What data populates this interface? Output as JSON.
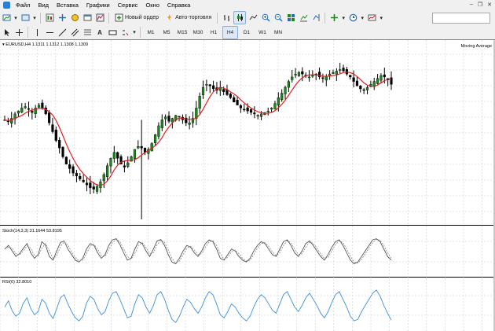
{
  "menu": [
    "Файл",
    "Вид",
    "Вставка",
    "Графики",
    "Сервис",
    "Окно",
    "Справка"
  ],
  "toolbar": {
    "new_order_label": "Новый ордер",
    "autotrading_label": "Авто-торговля"
  },
  "timeframes": [
    "M1",
    "M5",
    "M15",
    "M30",
    "H1",
    "H4",
    "D1",
    "W1",
    "MN"
  ],
  "drawing_tools": {
    "text_tool_label": "A"
  },
  "chart": {
    "header": "EURUSD,H4  1.1311 1.1312 1.1308 1.1309",
    "indicator_label": "Moving Average",
    "stoch_label": "Stoch(14,3,3) 31.1644 53.8195",
    "rsi_label": "RSI(6) 32.8010"
  },
  "colors": {
    "bull_candle": "#1a8a1a",
    "bear_candle": "#000000",
    "moving_average": "#e02020",
    "stochastic_main": "#404040",
    "stochastic_signal": "#808080",
    "rsi": "#3b8fdc",
    "grid": "#c8c8c8"
  },
  "chart_data": {
    "type": "candlestick",
    "symbol": "EURUSD",
    "timeframe": "H4",
    "price_path": [
      0.62,
      0.61,
      0.63,
      0.66,
      0.68,
      0.7,
      0.71,
      0.69,
      0.67,
      0.7,
      0.72,
      0.7,
      0.66,
      0.6,
      0.54,
      0.48,
      0.43,
      0.37,
      0.32,
      0.29,
      0.26,
      0.24,
      0.22,
      0.2,
      0.18,
      0.16,
      0.15,
      0.17,
      0.2,
      0.25,
      0.31,
      0.36,
      0.4,
      0.36,
      0.32,
      0.3,
      0.33,
      0.37,
      0.42,
      0.44,
      0.43,
      0.4,
      0.42,
      0.46,
      0.52,
      0.58,
      0.62,
      0.64,
      0.61,
      0.63,
      0.65,
      0.64,
      0.62,
      0.6,
      0.6,
      0.63,
      0.7,
      0.78,
      0.84,
      0.86,
      0.85,
      0.83,
      0.82,
      0.84,
      0.81,
      0.79,
      0.77,
      0.74,
      0.72,
      0.7,
      0.69,
      0.68,
      0.67,
      0.66,
      0.65,
      0.66,
      0.67,
      0.68,
      0.7,
      0.73,
      0.77,
      0.8,
      0.84,
      0.88,
      0.91,
      0.93,
      0.94,
      0.93,
      0.92,
      0.91,
      0.92,
      0.93,
      0.91,
      0.9,
      0.91,
      0.93,
      0.94,
      0.95,
      0.96,
      0.95,
      0.93,
      0.91,
      0.88,
      0.85,
      0.83,
      0.82,
      0.84,
      0.86,
      0.88,
      0.9,
      0.92,
      0.91,
      0.89,
      0.86
    ],
    "stochastic": [
      60,
      70,
      55,
      40,
      48,
      62,
      75,
      50,
      35,
      45,
      80,
      70,
      40,
      30,
      55,
      78,
      82,
      60,
      45,
      30,
      25,
      35,
      60,
      75,
      70,
      50,
      35,
      45,
      70,
      85,
      88,
      72,
      50,
      30,
      35,
      60,
      80,
      75,
      55,
      40,
      60,
      82,
      86,
      70,
      45,
      25,
      20,
      35,
      55,
      70,
      65,
      50,
      40,
      55,
      75,
      85,
      80,
      60,
      35,
      30,
      45,
      60,
      55,
      40,
      30,
      25,
      35,
      55,
      70,
      80,
      75,
      60,
      45,
      40,
      60,
      80,
      85,
      70,
      50,
      40,
      55,
      75,
      82,
      70,
      55,
      40,
      30,
      45,
      65,
      80,
      85,
      70,
      50,
      30,
      20,
      25,
      40,
      55,
      70,
      85,
      88,
      80,
      60,
      40,
      30
    ],
    "rsi": [
      50,
      58,
      45,
      38,
      42,
      55,
      62,
      48,
      40,
      44,
      60,
      55,
      42,
      35,
      48,
      62,
      66,
      54,
      44,
      36,
      32,
      38,
      55,
      64,
      60,
      48,
      40,
      44,
      58,
      68,
      70,
      60,
      48,
      36,
      38,
      54,
      66,
      62,
      50,
      42,
      52,
      66,
      70,
      60,
      46,
      34,
      30,
      38,
      50,
      60,
      56,
      48,
      42,
      50,
      62,
      70,
      66,
      54,
      40,
      36,
      44,
      54,
      50,
      42,
      36,
      32,
      38,
      50,
      60,
      66,
      62,
      54,
      46,
      42,
      54,
      66,
      70,
      60,
      50,
      44,
      52,
      62,
      68,
      60,
      52,
      42,
      36,
      44,
      56,
      66,
      70,
      60,
      50,
      38,
      32,
      34,
      44,
      52,
      60,
      68,
      72,
      64,
      52,
      42,
      33
    ]
  }
}
